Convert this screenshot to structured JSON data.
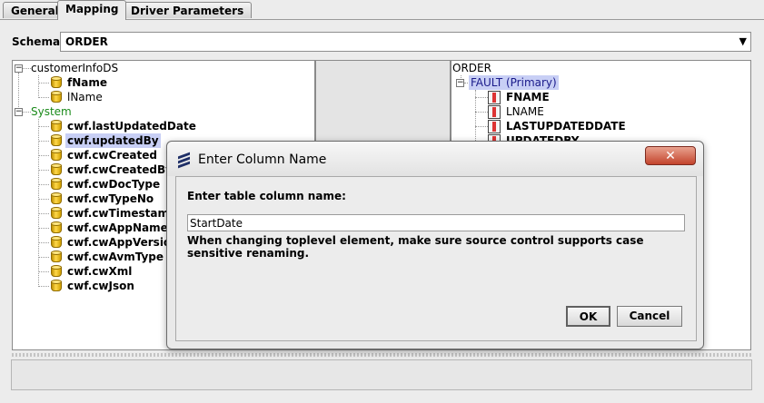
{
  "tabs": [
    {
      "label": "General"
    },
    {
      "label": "Mapping"
    },
    {
      "label": "Driver Parameters"
    }
  ],
  "schema": {
    "label": "Schema:",
    "value": "ORDER",
    "arrow": "▼"
  },
  "left_tree": {
    "root1": "customerInfoDS",
    "root1_children": [
      "fName",
      "lName"
    ],
    "root2": "System",
    "root2_children": [
      "cwf.lastUpdatedDate",
      "cwf.updatedBy",
      "cwf.cwCreated",
      "cwf.cwCreatedBy",
      "cwf.cwDocType",
      "cwf.cwTypeNo",
      "cwf.cwTimestamp",
      "cwf.cwAppName",
      "cwf.cwAppVersion",
      "cwf.cwAvmType",
      "cwf.cwXml",
      "cwf.cwJson"
    ]
  },
  "right_tree": {
    "root": "ORDER",
    "table": "FAULT (Primary)",
    "columns": [
      "FNAME",
      "LNAME",
      "LASTUPDATEDDATE",
      "UPDATEDBY"
    ]
  },
  "dialog": {
    "title": "Enter Column Name",
    "close_label": "✕",
    "prompt": "Enter table column name:",
    "input_value": "StartDate",
    "note": "When changing toplevel element, make sure source control supports case sensitive renaming.",
    "ok_label": "OK",
    "cancel_label": "Cancel"
  }
}
